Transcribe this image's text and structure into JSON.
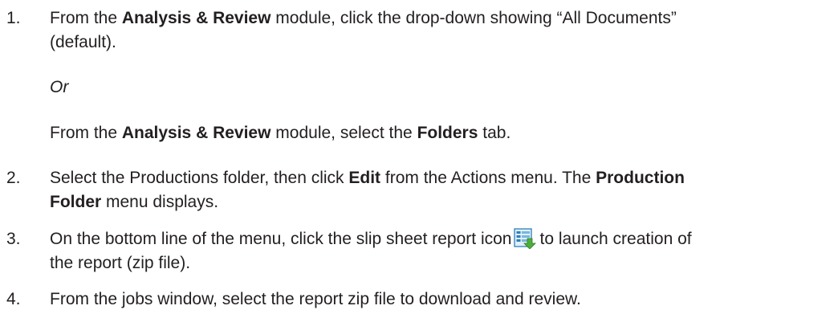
{
  "steps": [
    {
      "number": "1.",
      "line1": {
        "pre": "From the ",
        "bold": "Analysis & Review",
        "post": " module, click the drop-down showing “All Documents”"
      },
      "line2": "(default).",
      "or_text": "Or",
      "alt": {
        "pre": "From the ",
        "bold1": "Analysis & Review",
        "mid": " module, select the ",
        "bold2": "Folders",
        "post": " tab."
      }
    },
    {
      "number": "2.",
      "line1": {
        "pre": "Select the Productions folder, then click ",
        "bold1": "Edit",
        "mid": " from the Actions menu. The ",
        "bold2": "Production"
      },
      "line2": {
        "bold": "Folder",
        "post": " menu displays."
      }
    },
    {
      "number": "3.",
      "line1": {
        "pre": "On the bottom line of the menu, click the slip sheet report icon",
        "post": "to launch creation of"
      },
      "line2": "the report (zip file).",
      "icon": "slip-sheet-report-icon"
    },
    {
      "number": "4.",
      "line1": "From the jobs window, select the report zip file to download and review."
    }
  ]
}
